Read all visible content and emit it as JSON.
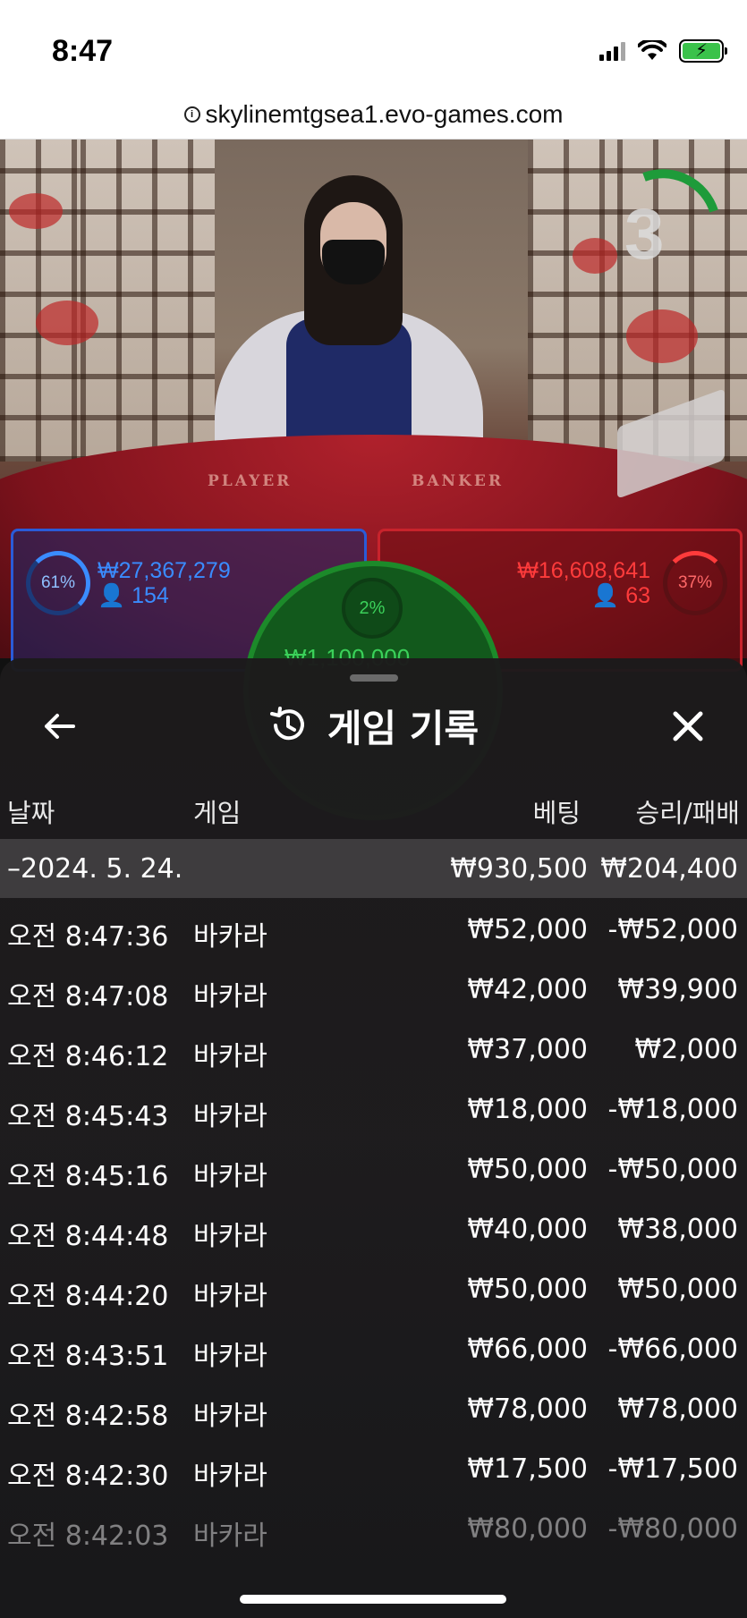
{
  "status_bar": {
    "time": "8:47"
  },
  "browser": {
    "url": "skylinemtgsea1.evo-games.com"
  },
  "video": {
    "countdown": "3",
    "table_labels": {
      "player": "PLAYER",
      "banker": "BANKER"
    }
  },
  "bets": {
    "player": {
      "percent": "61%",
      "amount": "₩27,367,279",
      "players": "154"
    },
    "banker": {
      "percent": "37%",
      "amount": "₩16,608,641",
      "players": "63"
    },
    "tie": {
      "percent": "2%",
      "amount": "₩1,100,000"
    }
  },
  "history": {
    "title": "게임 기록",
    "columns": {
      "date": "날짜",
      "game": "게임",
      "bet": "베팅",
      "result": "승리/패배"
    },
    "date_group": {
      "date": "–2024. 5. 24.",
      "bet_total": "₩930,500",
      "result_total": "₩204,400"
    },
    "rows": [
      {
        "time": "오전 8:47:36",
        "game": "바카라",
        "bet": "₩52,000",
        "result": "-₩52,000"
      },
      {
        "time": "오전 8:47:08",
        "game": "바카라",
        "bet": "₩42,000",
        "result": "₩39,900"
      },
      {
        "time": "오전 8:46:12",
        "game": "바카라",
        "bet": "₩37,000",
        "result": "₩2,000"
      },
      {
        "time": "오전 8:45:43",
        "game": "바카라",
        "bet": "₩18,000",
        "result": "-₩18,000"
      },
      {
        "time": "오전 8:45:16",
        "game": "바카라",
        "bet": "₩50,000",
        "result": "-₩50,000"
      },
      {
        "time": "오전 8:44:48",
        "game": "바카라",
        "bet": "₩40,000",
        "result": "₩38,000"
      },
      {
        "time": "오전 8:44:20",
        "game": "바카라",
        "bet": "₩50,000",
        "result": "₩50,000"
      },
      {
        "time": "오전 8:43:51",
        "game": "바카라",
        "bet": "₩66,000",
        "result": "-₩66,000"
      },
      {
        "time": "오전 8:42:58",
        "game": "바카라",
        "bet": "₩78,000",
        "result": "₩78,000"
      },
      {
        "time": "오전 8:42:30",
        "game": "바카라",
        "bet": "₩17,500",
        "result": "-₩17,500"
      },
      {
        "time": "오전 8:42:03",
        "game": "바카라",
        "bet": "₩80,000",
        "result": "-₩80,000"
      }
    ]
  },
  "colors": {
    "player_blue": "#3a8cff",
    "banker_red": "#ff3b3b",
    "tie_green": "#3bd15a"
  }
}
